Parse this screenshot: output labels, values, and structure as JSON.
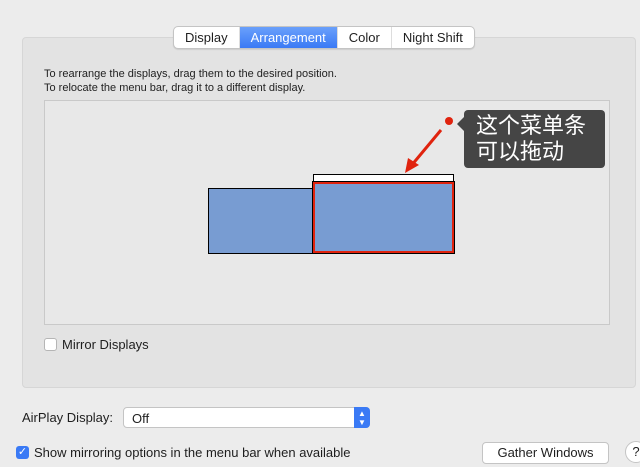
{
  "tabs": [
    {
      "label": "Display"
    },
    {
      "label": "Arrangement",
      "active": true
    },
    {
      "label": "Color"
    },
    {
      "label": "Night Shift"
    }
  ],
  "instructions": {
    "line1": "To rearrange the displays, drag them to the desired position.",
    "line2": "To relocate the menu bar, drag it to a different display."
  },
  "annotation": {
    "line1": "这个菜单条",
    "line2": "可以拖动",
    "color": "#e0230e"
  },
  "mirror": {
    "label": "Mirror Displays",
    "checked": false
  },
  "airplay": {
    "label": "AirPlay Display:",
    "value": "Off"
  },
  "show_mirroring": {
    "label": "Show mirroring options in the menu bar when available",
    "checked": true
  },
  "gather_button": "Gather Windows",
  "help_button": "?",
  "colors": {
    "accent": "#3a7af5",
    "display_fill": "#789cd2"
  }
}
